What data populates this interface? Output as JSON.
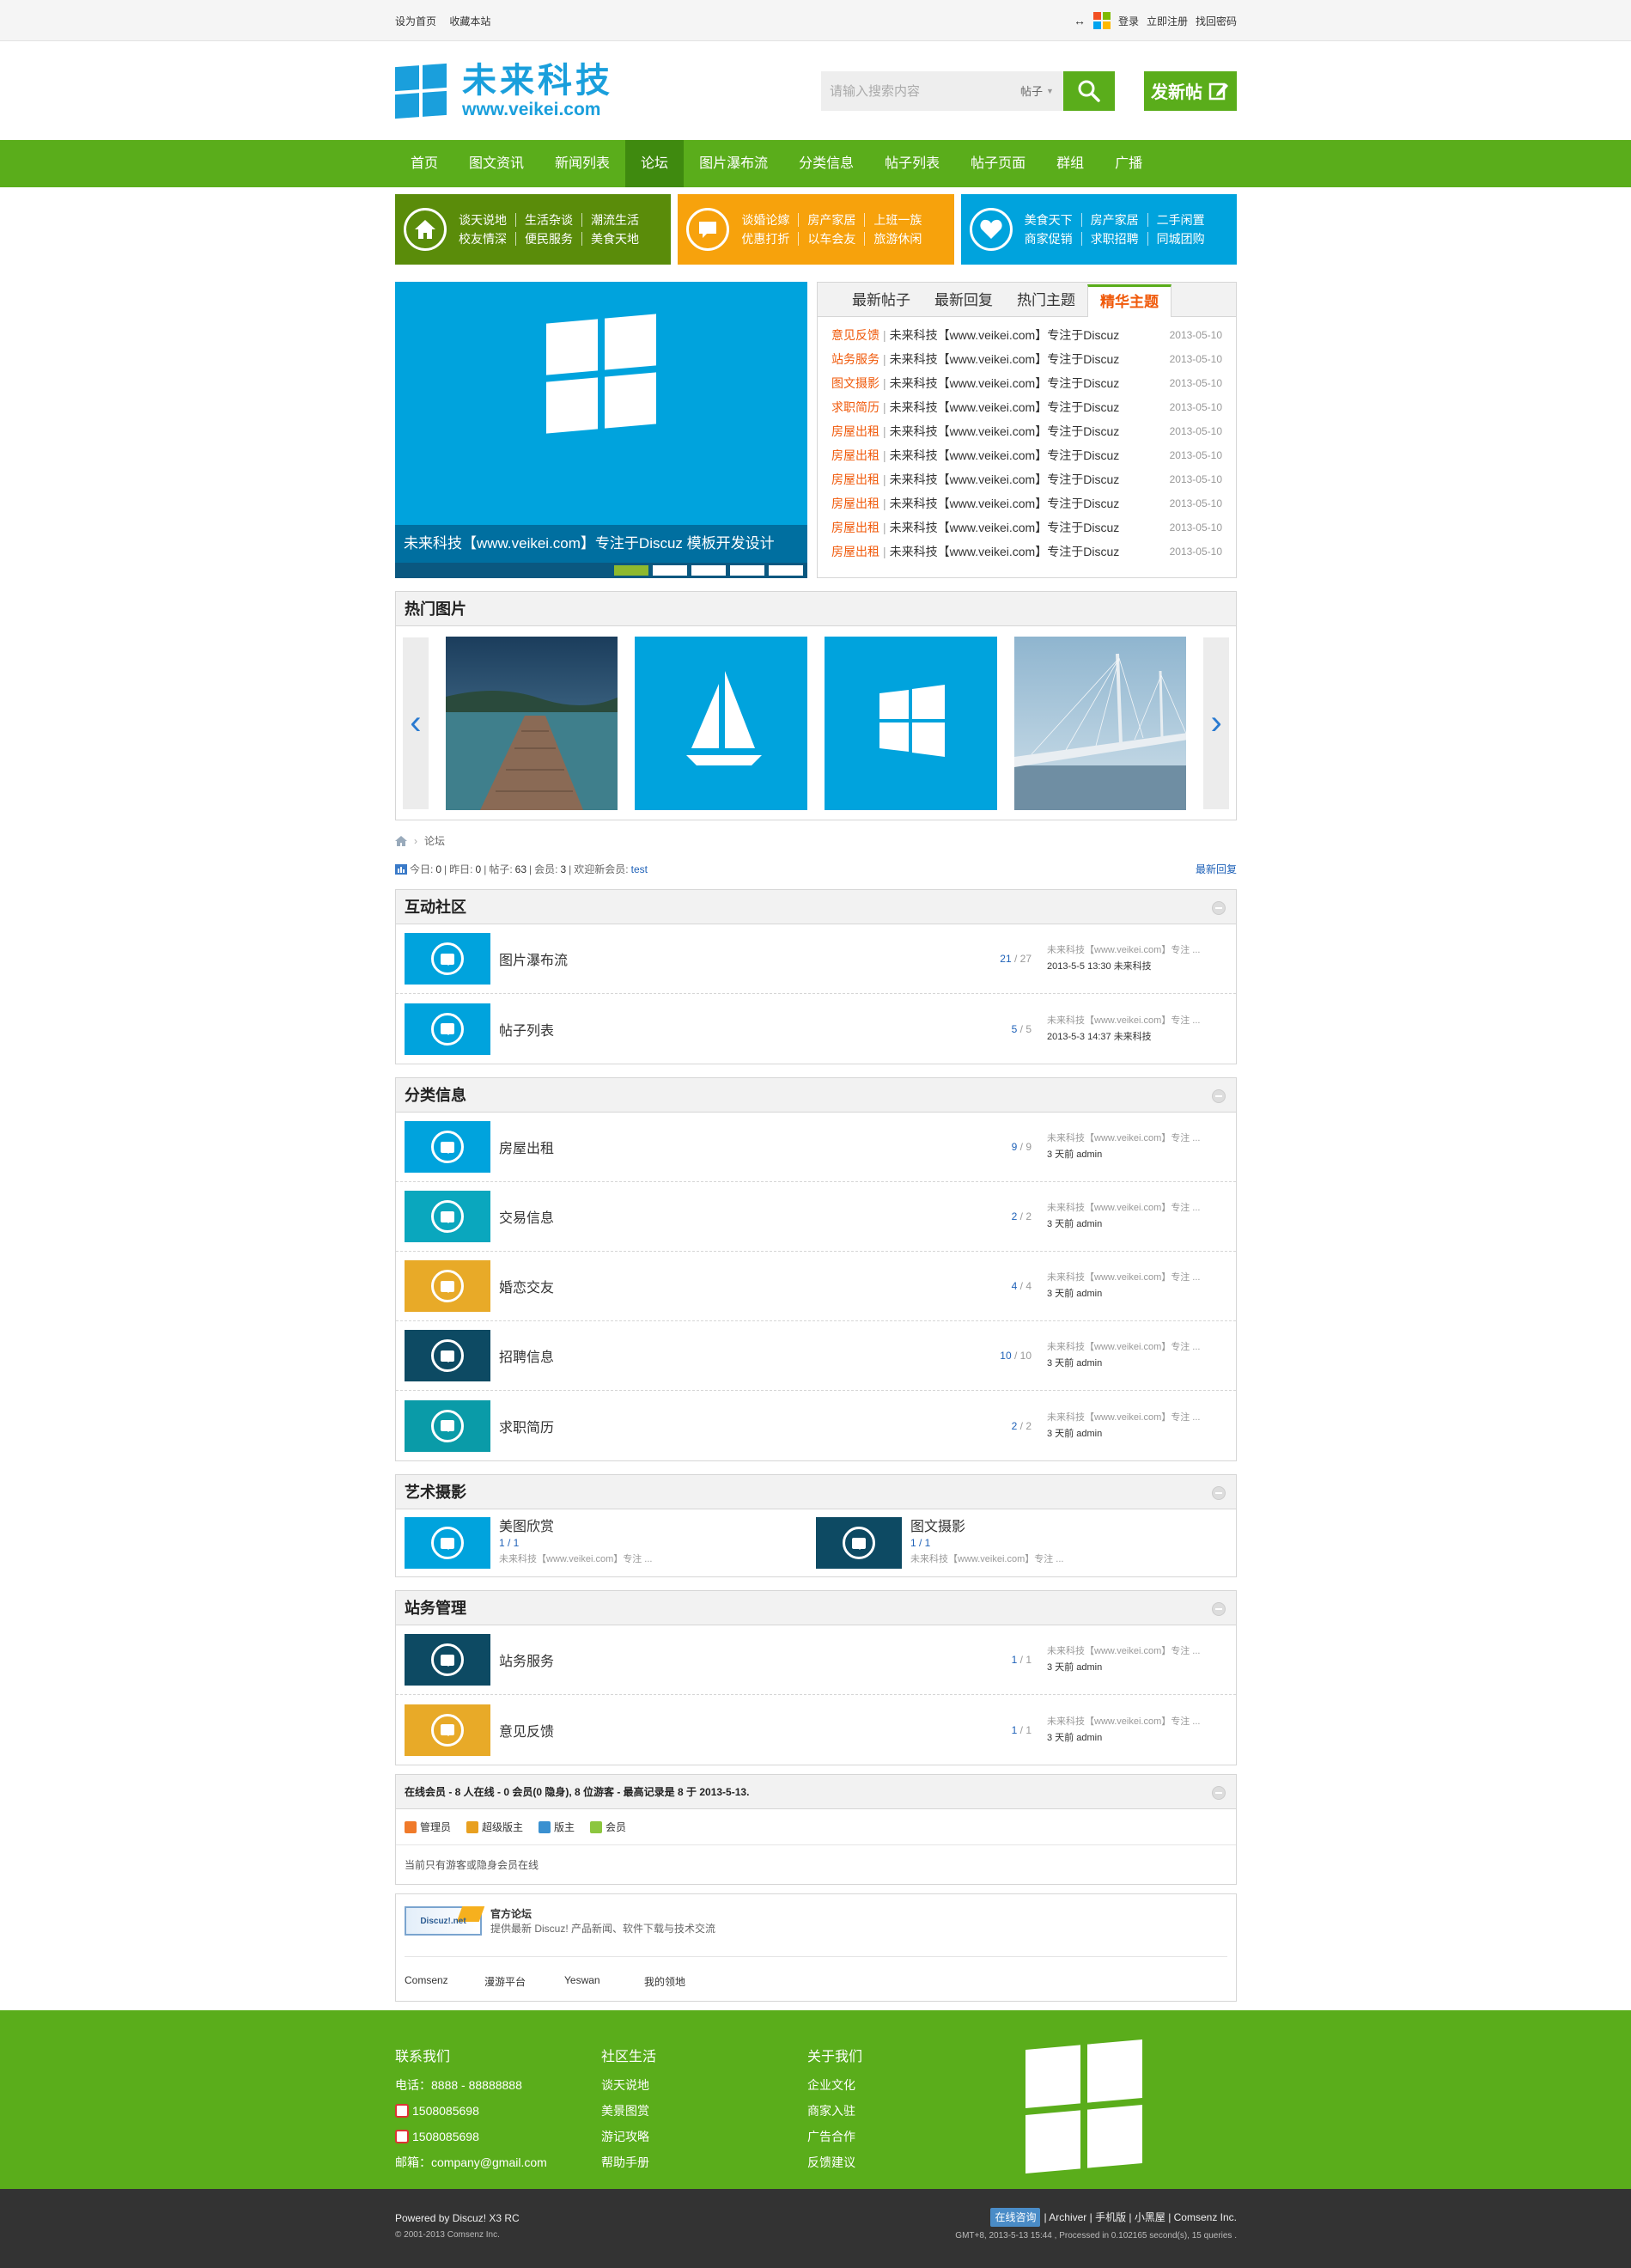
{
  "topbar": {
    "left_links": [
      "设为首页",
      "收藏本站"
    ],
    "right_links": [
      "登录",
      "立即注册",
      "找回密码"
    ]
  },
  "header": {
    "logo_cn": "未来科技",
    "logo_en": "www.veikei.com",
    "search_placeholder": "请输入搜索内容",
    "search_type": "帖子",
    "post_button": "发新帖"
  },
  "nav": {
    "items": [
      "首页",
      "图文资讯",
      "新闻列表",
      "论坛",
      "图片瀑布流",
      "分类信息",
      "帖子列表",
      "帖子页面",
      "群组",
      "广播"
    ],
    "active": "论坛"
  },
  "quick": [
    {
      "color": "#5a8c0a",
      "icon": "home-icon",
      "links": [
        "谈天说地",
        "生活杂谈",
        "潮流生活",
        "校友情深",
        "便民服务",
        "美食天地"
      ]
    },
    {
      "color": "#f7a20c",
      "icon": "chat-icon",
      "links": [
        "谈婚论嫁",
        "房产家居",
        "上班一族",
        "优惠打折",
        "以车会友",
        "旅游休闲"
      ]
    },
    {
      "color": "#00a3dd",
      "icon": "heart-icon",
      "links": [
        "美食天下",
        "房产家居",
        "二手闲置",
        "商家促销",
        "求职招聘",
        "同城团购"
      ]
    }
  ],
  "slider": {
    "caption": "未来科技【www.veikei.com】专注于Discuz 模板开发设计"
  },
  "tabs": {
    "items": [
      "最新帖子",
      "最新回复",
      "热门主题",
      "精华主题"
    ],
    "active": "精华主题",
    "list": [
      {
        "cat": "意见反馈",
        "title": "未来科技【www.veikei.com】专注于Discuz",
        "date": "2013-05-10"
      },
      {
        "cat": "站务服务",
        "title": "未来科技【www.veikei.com】专注于Discuz",
        "date": "2013-05-10"
      },
      {
        "cat": "图文摄影",
        "title": "未来科技【www.veikei.com】专注于Discuz",
        "date": "2013-05-10"
      },
      {
        "cat": "求职简历",
        "title": "未来科技【www.veikei.com】专注于Discuz",
        "date": "2013-05-10"
      },
      {
        "cat": "房屋出租",
        "title": "未来科技【www.veikei.com】专注于Discuz",
        "date": "2013-05-10"
      },
      {
        "cat": "房屋出租",
        "title": "未来科技【www.veikei.com】专注于Discuz",
        "date": "2013-05-10"
      },
      {
        "cat": "房屋出租",
        "title": "未来科技【www.veikei.com】专注于Discuz",
        "date": "2013-05-10"
      },
      {
        "cat": "房屋出租",
        "title": "未来科技【www.veikei.com】专注于Discuz",
        "date": "2013-05-10"
      },
      {
        "cat": "房屋出租",
        "title": "未来科技【www.veikei.com】专注于Discuz",
        "date": "2013-05-10"
      },
      {
        "cat": "房屋出租",
        "title": "未来科技【www.veikei.com】专注于Discuz",
        "date": "2013-05-10"
      }
    ]
  },
  "hotpics": {
    "title": "热门图片"
  },
  "crumb": {
    "current": "论坛"
  },
  "stats": {
    "today_label": "今日:",
    "today": "0",
    "yesterday_label": "昨日:",
    "yesterday": "0",
    "posts_label": "帖子:",
    "posts": "63",
    "members_label": "会员:",
    "members": "3",
    "newest_label": "欢迎新会员:",
    "newest": "test",
    "latest_reply": "最新回复"
  },
  "sections": [
    {
      "title": "互动社区",
      "forums": [
        {
          "name": "图片瀑布流",
          "threads": "21",
          "posts": "27",
          "color": "#00a3dd",
          "last_title": "未来科技【www.veikei.com】专注 ...",
          "last_time": "2013-5-5 13:30",
          "last_user": "未来科技"
        },
        {
          "name": "帖子列表",
          "threads": "5",
          "posts": "5",
          "color": "#00a3dd",
          "last_title": "未来科技【www.veikei.com】专注 ...",
          "last_time": "2013-5-3 14:37",
          "last_user": "未来科技"
        }
      ]
    },
    {
      "title": "分类信息",
      "forums": [
        {
          "name": "房屋出租",
          "threads": "9",
          "posts": "9",
          "color": "#00a3dd",
          "last_title": "未来科技【www.veikei.com】专注 ...",
          "last_time": "3 天前",
          "last_user": "admin"
        },
        {
          "name": "交易信息",
          "threads": "2",
          "posts": "2",
          "color": "#0aa7be",
          "last_title": "未来科技【www.veikei.com】专注 ...",
          "last_time": "3 天前",
          "last_user": "admin"
        },
        {
          "name": "婚恋交友",
          "threads": "4",
          "posts": "4",
          "color": "#e8aa28",
          "last_title": "未来科技【www.veikei.com】专注 ...",
          "last_time": "3 天前",
          "last_user": "admin"
        },
        {
          "name": "招聘信息",
          "threads": "10",
          "posts": "10",
          "color": "#0d4a63",
          "last_title": "未来科技【www.veikei.com】专注 ...",
          "last_time": "3 天前",
          "last_user": "admin"
        },
        {
          "name": "求职简历",
          "threads": "2",
          "posts": "2",
          "color": "#0a9ba8",
          "last_title": "未来科技【www.veikei.com】专注 ...",
          "last_time": "3 天前",
          "last_user": "admin"
        }
      ]
    }
  ],
  "art": {
    "title": "艺术摄影",
    "forums": [
      {
        "name": "美图欣赏",
        "count": "1 / 1",
        "color": "#00a3dd",
        "desc": "未来科技【www.veikei.com】专注 ..."
      },
      {
        "name": "图文摄影",
        "count": "1 / 1",
        "color": "#0d4a63",
        "desc": "未来科技【www.veikei.com】专注 ..."
      }
    ]
  },
  "admin_section": {
    "title": "站务管理",
    "forums": [
      {
        "name": "站务服务",
        "threads": "1",
        "posts": "1",
        "color": "#0d4a63",
        "last_title": "未来科技【www.veikei.com】专注 ...",
        "last_time": "3 天前",
        "last_user": "admin"
      },
      {
        "name": "意见反馈",
        "threads": "1",
        "posts": "1",
        "color": "#e8aa28",
        "last_title": "未来科技【www.veikei.com】专注 ...",
        "last_time": "3 天前",
        "last_user": "admin"
      }
    ]
  },
  "online": {
    "title": "在线会员 - 8 人在线 - 0 会员(0 隐身), 8 位游客 - 最高记录是 8 于 2013-5-13.",
    "legend": [
      "管理员",
      "超级版主",
      "版主",
      "会员"
    ],
    "legend_colors": [
      "#f07a2a",
      "#e8a020",
      "#3a90d0",
      "#8cc63f"
    ],
    "note": "当前只有游客或隐身会员在线"
  },
  "links": {
    "logo_text": "Discuz!.net",
    "title": "官方论坛",
    "desc": "提供最新 Discuz! 产品新闻、软件下载与技术交流",
    "items": [
      "Comsenz",
      "漫游平台",
      "Yeswan",
      "我的领地"
    ]
  },
  "footer": {
    "col1_title": "联系我们",
    "col1": [
      "电话：8888 - 88888888",
      "1508085698",
      "1508085698",
      "邮箱：company@gmail.com"
    ],
    "col2_title": "社区生活",
    "col2": [
      "谈天说地",
      "美景图赏",
      "游记攻略",
      "帮助手册"
    ],
    "col3_title": "关于我们",
    "col3": [
      "企业文化",
      "商家入驻",
      "广告合作",
      "反馈建议"
    ]
  },
  "copyright": {
    "powered": "Powered by Discuz! X3 RC",
    "years": "© 2001-2013 Comsenz Inc.",
    "online_consult": "在线咨询",
    "links": "| Archiver | 手机版 | 小黑屋 | Comsenz Inc.",
    "processed": "GMT+8, 2013-5-13 15:44 , Processed in 0.102165 second(s), 15 queries ."
  }
}
